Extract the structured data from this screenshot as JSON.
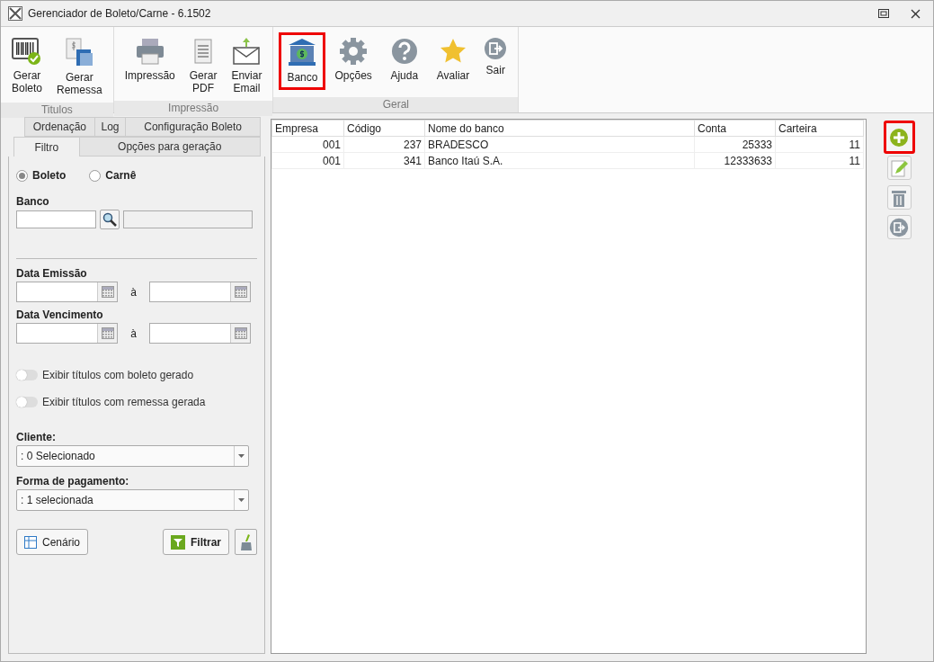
{
  "window": {
    "title": "Gerenciador de Boleto/Carne - 6.1502"
  },
  "ribbon": {
    "groups": [
      {
        "label": "Titulos",
        "buttons": [
          {
            "kind": "barcode",
            "lines": [
              "Gerar",
              "Boleto"
            ],
            "highlighted": false
          },
          {
            "kind": "remessa",
            "lines": [
              "Gerar",
              "Remessa"
            ],
            "highlighted": false
          }
        ]
      },
      {
        "label": "Impressão",
        "buttons": [
          {
            "kind": "printer",
            "lines": [
              "Impressão"
            ],
            "highlighted": false
          },
          {
            "kind": "pdf",
            "lines": [
              "Gerar",
              "PDF"
            ],
            "highlighted": false
          },
          {
            "kind": "email",
            "lines": [
              "Enviar",
              "Email"
            ],
            "highlighted": false
          }
        ]
      },
      {
        "label": "Geral",
        "buttons": [
          {
            "kind": "bank",
            "lines": [
              "Banco"
            ],
            "highlighted": true
          },
          {
            "kind": "gear",
            "lines": [
              "Opções"
            ],
            "highlighted": false
          },
          {
            "kind": "help",
            "lines": [
              "Ajuda"
            ],
            "highlighted": false
          },
          {
            "kind": "star",
            "lines": [
              "Avaliar"
            ],
            "highlighted": false
          },
          {
            "kind": "exit",
            "lines": [
              "Sair"
            ],
            "highlighted": false
          }
        ]
      }
    ]
  },
  "filter_panel": {
    "tab_rows": [
      [
        {
          "label": "Ordenação",
          "selected": false
        },
        {
          "label": "Log",
          "selected": false
        },
        {
          "label": "Configuração Boleto",
          "selected": false
        }
      ],
      [
        {
          "label": "Filtro",
          "selected": true
        },
        {
          "label": "Opções para geração",
          "selected": false
        }
      ]
    ],
    "radios": [
      {
        "label": "Boleto",
        "selected": true
      },
      {
        "label": "Carnê",
        "selected": false
      }
    ],
    "bank_label": "Banco",
    "date_ranges": [
      {
        "label": "Data Emissão",
        "separator": "à"
      },
      {
        "label": "Data Vencimento",
        "separator": "à"
      }
    ],
    "toggles": [
      {
        "label": "Exibir títulos com boleto gerado",
        "on": false
      },
      {
        "label": "Exibir títulos com remessa gerada",
        "on": false
      }
    ],
    "dropdowns": [
      {
        "label": "Cliente:",
        "value": ": 0 Selecionado"
      },
      {
        "label": "Forma de pagamento:",
        "value": ": 1 selecionada"
      }
    ],
    "scenario_button": "Cenário",
    "filter_button": "Filtrar"
  },
  "table": {
    "columns": [
      "Empresa",
      "Código",
      "Nome do banco",
      "Conta",
      "Carteira"
    ],
    "rows": [
      [
        "001",
        "237",
        "BRADESCO",
        "25333",
        "11"
      ],
      [
        "001",
        "341",
        "Banco Itaú S.A.",
        "12333633",
        "11"
      ]
    ]
  },
  "side_buttons": [
    {
      "kind": "add",
      "highlighted": true
    },
    {
      "kind": "edit",
      "highlighted": false
    },
    {
      "kind": "delete",
      "highlighted": false
    },
    {
      "kind": "exit",
      "highlighted": false
    }
  ]
}
